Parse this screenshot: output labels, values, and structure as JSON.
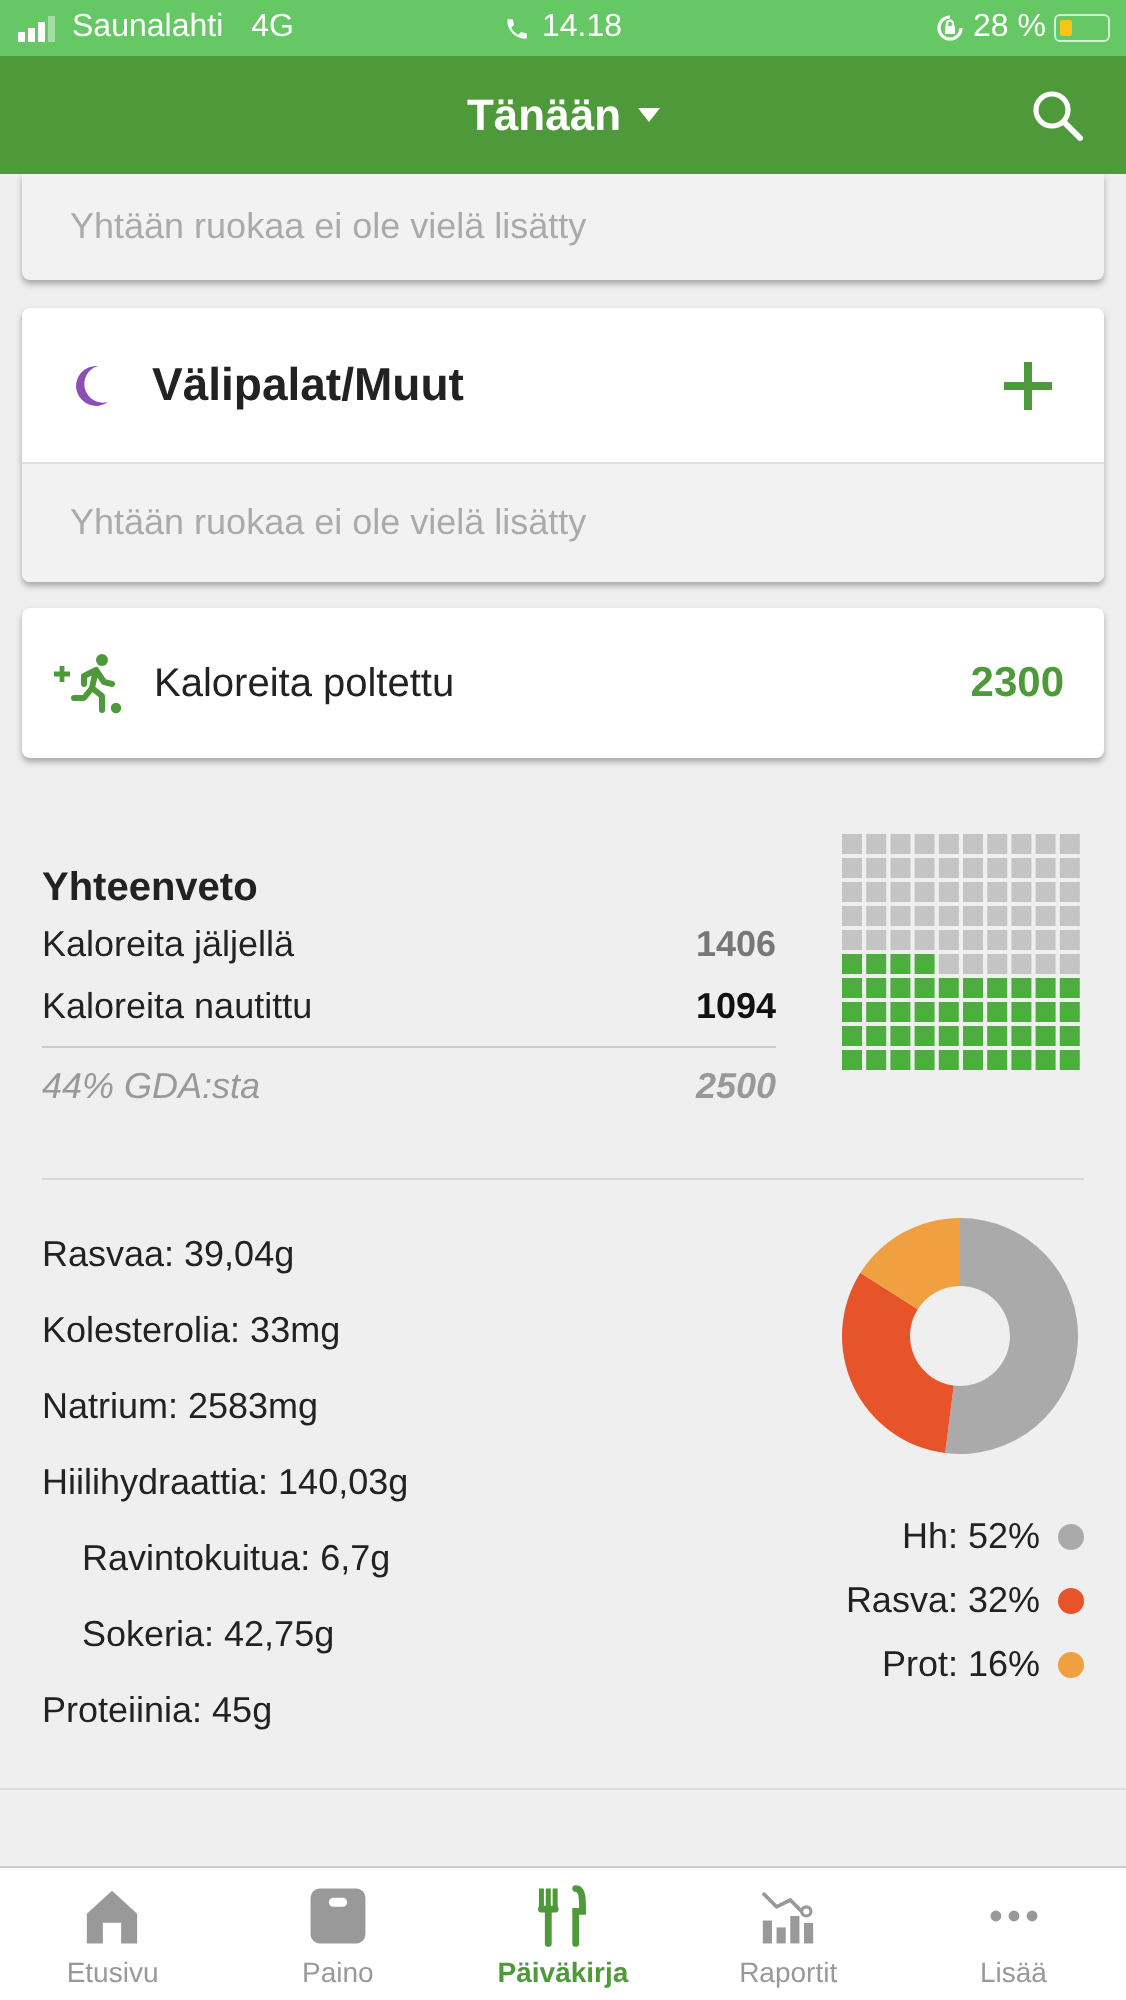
{
  "status_bar": {
    "carrier": "Saunalahti",
    "network": "4G",
    "time": "14.18",
    "battery_text": "28 %"
  },
  "header": {
    "title": "Tänään"
  },
  "meals": [
    {
      "kind": "partial",
      "empty_text": "Yhtään ruokaa ei ole vielä lisätty"
    },
    {
      "kind": "full",
      "name": "Välipalat/Muut",
      "empty_text": "Yhtään ruokaa ei ole vielä lisätty"
    }
  ],
  "exercise": {
    "label": "Kaloreita poltettu",
    "value": "2300"
  },
  "summary": {
    "title": "Yhteenveto",
    "rows": [
      {
        "label": "Kaloreita jäljellä",
        "value": "1406",
        "emphasis": false
      },
      {
        "label": "Kaloreita nautittu",
        "value": "1094",
        "emphasis": true
      }
    ],
    "gda_label": "44% GDA:sta",
    "gda_value": "2500"
  },
  "nutrients": [
    {
      "text": "Rasvaa: 39,04g"
    },
    {
      "text": "Kolesterolia: 33mg"
    },
    {
      "text": "Natrium: 2583mg"
    },
    {
      "text": "Hiilihydraattia: 140,03g",
      "children": [
        {
          "text": "Ravintokuitua: 6,7g"
        },
        {
          "text": "Sokeria: 42,75g"
        }
      ]
    },
    {
      "text": "Proteiinia: 45g"
    }
  ],
  "macros": {
    "chart_data": {
      "type": "donut",
      "values": [
        52,
        32,
        16
      ]
    },
    "legend": [
      {
        "text": "Hh: 52%",
        "color": "#aaaaaa"
      },
      {
        "text": "Rasva: 32%",
        "color": "#e8542a"
      },
      {
        "text": "Prot: 16%",
        "color": "#f0a040"
      }
    ]
  },
  "tabs": [
    {
      "kind": "home",
      "label": "Etusivu",
      "selected": false
    },
    {
      "kind": "scale",
      "label": "Paino",
      "selected": false
    },
    {
      "kind": "diary",
      "label": "Päiväkirja",
      "selected": true
    },
    {
      "kind": "reports",
      "label": "Raportit",
      "selected": false
    },
    {
      "kind": "more",
      "label": "Lisää",
      "selected": false
    }
  ]
}
